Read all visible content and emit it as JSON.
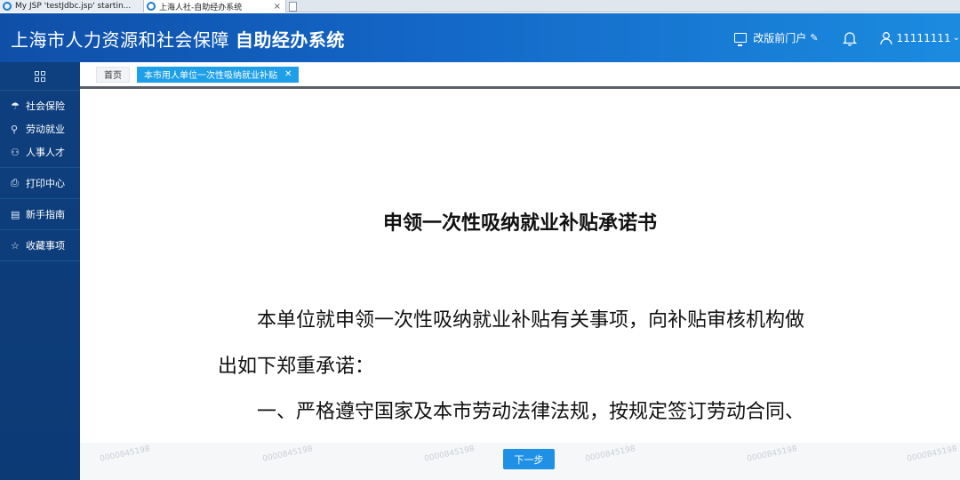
{
  "browser_tabs": [
    {
      "label": "My JSP 'testJdbc.jsp' startin..."
    },
    {
      "label": "上海人社-自助经办系统"
    }
  ],
  "header": {
    "title_main": "上海市人力资源和社会保障 ",
    "title_bold": "自助经办系统",
    "portal_label": "改版前门户",
    "username": "11111111"
  },
  "sidebar": {
    "groups": [
      {
        "items": [
          {
            "label": "社会保险",
            "icon": "umbrella-icon"
          },
          {
            "label": "劳动就业",
            "icon": "worker-icon"
          },
          {
            "label": "人事人才",
            "icon": "people-icon"
          }
        ]
      },
      {
        "items": [
          {
            "label": "打印中心",
            "icon": "printer-icon"
          }
        ]
      },
      {
        "items": [
          {
            "label": "新手指南",
            "icon": "guide-icon"
          }
        ]
      },
      {
        "items": [
          {
            "label": "收藏事项",
            "icon": "star-icon"
          }
        ]
      }
    ]
  },
  "content_tabs": {
    "home": "首页",
    "active": "本市用人单位一次性吸纳就业补贴"
  },
  "document": {
    "title": "申领一次性吸纳就业补贴承诺书",
    "para1": "本单位就申领一次性吸纳就业补贴有关事项，向补贴审核机构做",
    "para2": "出如下郑重承诺：",
    "para3": "一、严格遵守国家及本市劳动法律法规，按规定签订劳动合同、"
  },
  "footer": {
    "next_label": "下一步",
    "watermark": "0000845198"
  },
  "colors": {
    "header_start": "#0f4fa8",
    "header_end": "#1b8be0",
    "sidebar": "#0e3f7e",
    "active_tab": "#1ea0e8",
    "next_button": "#1e90e6"
  }
}
